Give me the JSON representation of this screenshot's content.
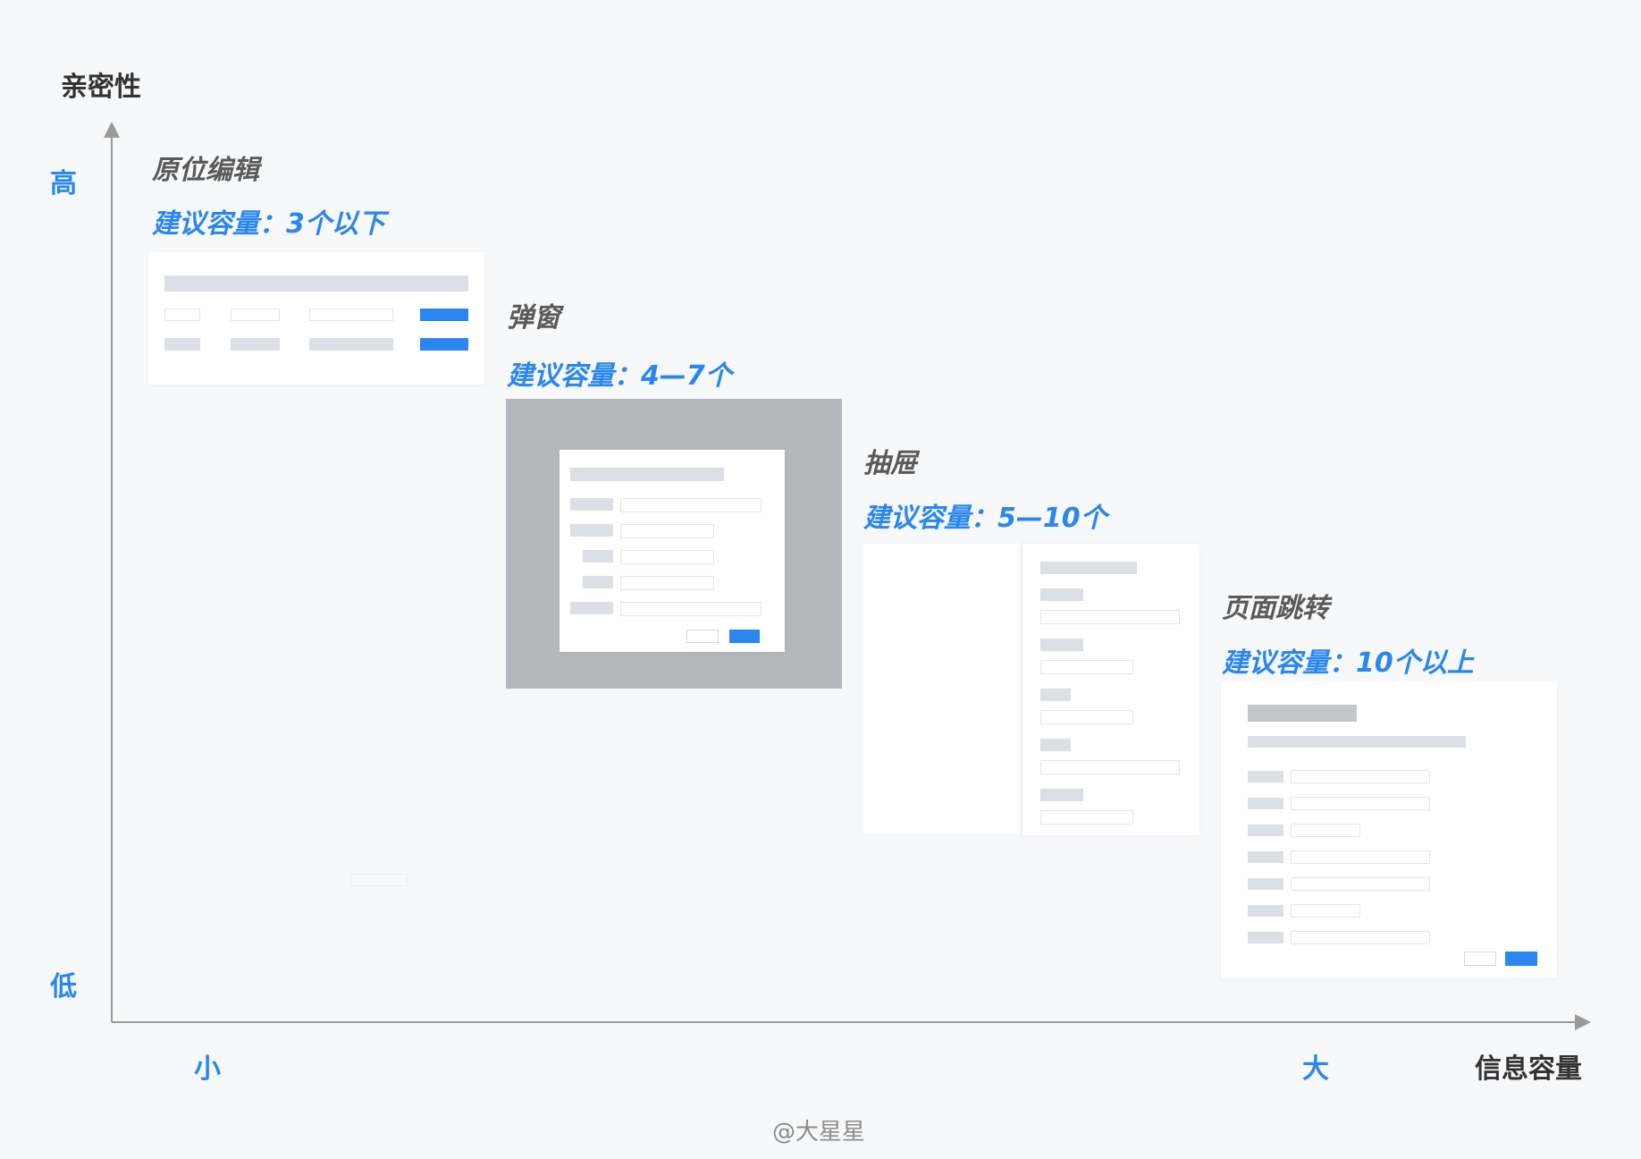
{
  "axes": {
    "y_title": "亲密性",
    "y_high": "高",
    "y_low": "低",
    "x_title": "信息容量",
    "x_small": "小",
    "x_large": "大"
  },
  "sections": [
    {
      "title": "原位编辑",
      "capacity": "建议容量：3个以下"
    },
    {
      "title": "弹窗",
      "capacity": "建议容量：4—7个"
    },
    {
      "title": "抽屉",
      "capacity": "建议容量：5—10个"
    },
    {
      "title": "页面跳转",
      "capacity": "建议容量：10个以上"
    }
  ],
  "credit": "@大星星",
  "colors": {
    "accent": "#2a86f0",
    "background": "#f7f8fa",
    "placeholder": "#dcdfe6",
    "overlay": "#b6b7bd"
  }
}
